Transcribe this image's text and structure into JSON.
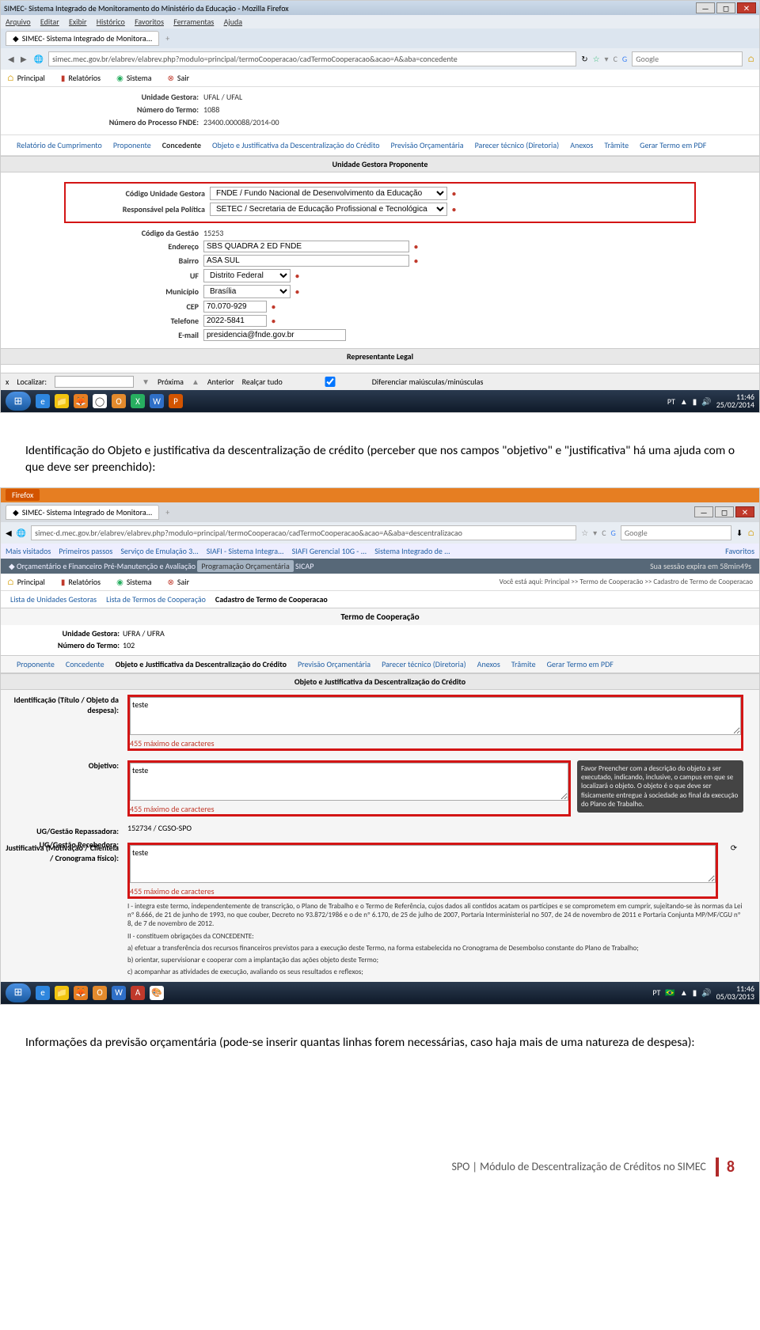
{
  "shot1": {
    "title": "SIMEC- Sistema Integrado de Monitoramento do Ministério da Educação - Mozilla Firefox",
    "menu": [
      "Arquivo",
      "Editar",
      "Exibir",
      "Histórico",
      "Favoritos",
      "Ferramentas",
      "Ajuda"
    ],
    "tab": "SIMEC- Sistema Integrado de Monitora...",
    "url": "simec.mec.gov.br/elabrev/elabrev.php?modulo=principal/termoCooperacao/cadTermoCooperacao&acao=A&aba=concedente",
    "search": "Google",
    "nav": {
      "principal": "Principal",
      "relatorios": "Relatórios",
      "sistema": "Sistema",
      "sair": "Sair"
    },
    "hdr": {
      "ug_lbl": "Unidade Gestora:",
      "ug_val": "UFAL / UFAL",
      "num_lbl": "Número do Termo:",
      "num_val": "1088",
      "proc_lbl": "Número do Processo FNDE:",
      "proc_val": "23400.000088/2014-00"
    },
    "tabs": [
      "Relatório de Cumprimento",
      "Proponente",
      "Concedente",
      "Objeto e Justificativa da Descentralização do Crédito",
      "Previsão Orçamentária",
      "Parecer técnico (Diretoria)",
      "Anexos",
      "Trâmite",
      "Gerar Termo em PDF"
    ],
    "active_tab": "Concedente",
    "sect1": "Unidade Gestora Proponente",
    "fields": {
      "cod_lbl": "Código Unidade Gestora",
      "cod_val": "FNDE / Fundo Nacional de Desenvolvimento da Educação",
      "resp_lbl": "Responsável pela Política",
      "resp_val": "SETEC / Secretaria de Educação Profissional e Tecnológica",
      "gest_lbl": "Código da Gestão",
      "gest_val": "15253",
      "end_lbl": "Endereço",
      "end_val": "SBS QUADRA 2 ED FNDE",
      "bairro_lbl": "Bairro",
      "bairro_val": "ASA SUL",
      "uf_lbl": "UF",
      "uf_val": "Distrito Federal",
      "mun_lbl": "Município",
      "mun_val": "Brasília",
      "cep_lbl": "CEP",
      "cep_val": "70.070-929",
      "tel_lbl": "Telefone",
      "tel_val": "2022-5841",
      "email_lbl": "E-mail",
      "email_val": "presidencia@fnde.gov.br"
    },
    "sect2": "Representante Legal",
    "find": {
      "x": "x",
      "loc": "Localizar:",
      "prox": "Próxima",
      "ant": "Anterior",
      "real": "Realçar tudo",
      "dif": "Diferenciar maiúsculas/minúsculas"
    },
    "clock": {
      "time": "11:46",
      "date": "25/02/2014",
      "lang": "PT"
    }
  },
  "para1": "Identificação do Objeto e justificativa da descentralização de crédito (perceber que nos campos \"objetivo\" e \"justificativa\" há uma ajuda com o que deve ser preenchido):",
  "shot2": {
    "fxbtn": "Firefox",
    "tab": "SIMEC- Sistema Integrado de Monitora...",
    "url": "simec-d.mec.gov.br/elabrev/elabrev.php?modulo=principal/termoCooperacao/cadTermoCooperacao&acao=A&aba=descentralizacao",
    "search": "Google",
    "bookmarks": [
      "Mais visitados",
      "Primeiros passos",
      "Serviço de Emulação 3...",
      "SIAFI - Sistema Integra...",
      "SIAFI Gerencial 10G - ...",
      "Sistema Integrado de ..."
    ],
    "fav": "Favoritos",
    "bc": "Orçamentário e Financeiro",
    "bc2": "Pré-Manutenção e Avaliação",
    "bc3": "Programação Orçamentária",
    "bc4": "SICAP",
    "session": "Sua sessão expira em 58min49s",
    "nav": {
      "principal": "Principal",
      "relatorios": "Relatórios",
      "sistema": "Sistema",
      "sair": "Sair"
    },
    "path": "Você está aqui: Principal >> Termo de Cooperacão >> Cadastro de Termo de Cooperacao",
    "lists": [
      "Lista de Unidades Gestoras",
      "Lista de Termos de Cooperação",
      "Cadastro de Termo de Cooperacao"
    ],
    "title": "Termo de Cooperação",
    "ug_lbl": "Unidade Gestora:",
    "ug_val": "UFRA / UFRA",
    "num_lbl": "Número do Termo:",
    "num_val": "102",
    "tabs": [
      "Proponente",
      "Concedente",
      "Objeto e Justificativa da Descentralização do Crédito",
      "Previsão Orçamentária",
      "Parecer técnico (Diretoria)",
      "Anexos",
      "Trâmite",
      "Gerar Termo em PDF"
    ],
    "active": "Objeto e Justificativa da Descentralização do Crédito",
    "sect": "Objeto e Justificativa da Descentralização do Crédito",
    "id_lbl": "Identificação (Título / Objeto da despesa):",
    "obj_lbl": "Objetivo:",
    "just_lbl": "Justificativa (Motivação / Clientela / Cronograma físico):",
    "ugrep_lbl": "UG/Gestão Repassadora:",
    "ugrep_val": "152734 / CGSO-SPO",
    "ugrec_lbl": "UG/Gestão Recebedora:",
    "teste": "teste",
    "counter": "455 máximo de caracteres",
    "tooltip": "Favor Preencher com a descrição do objeto a ser executado, indicando, inclusive, o campus em que se localizará o objeto. O objeto é o que deve ser fisicamente entregue à sociedade ao final da execução do Plano de Trabalho.",
    "footnote_i": "I - integra este termo, independentemente de transcrição, o Plano de Trabalho e o Termo de Referência, cujos dados ali contidos acatam os partícipes e se comprometem em cumprir, sujeitando-se às normas da Lei nº 8.666, de 21 de junho de 1993, no que couber, Decreto no 93.872/1986 e o de nº 6.170, de 25 de julho de 2007, Portaria Interministerial no 507, de 24 de novembro de 2011 e Portaria Conjunta MP/MF/CGU nº 8, de 7 de novembro de 2012.",
    "footnote_ii": "II - constituem obrigações da CONCEDENTE:",
    "fa": "a) efetuar a transferência dos recursos financeiros previstos para a execução deste Termo, na forma estabelecida no Cronograma de Desembolso constante do Plano de Trabalho;",
    "fb": "b) orientar, supervisionar e cooperar com a implantação das ações objeto deste Termo;",
    "fc": "c) acompanhar as atividades de execução, avaliando os seus resultados e reflexos;",
    "clock": {
      "time": "11:46",
      "date": "05/03/2013",
      "lang": "PT"
    }
  },
  "para2": "Informações da previsão orçamentária (pode-se inserir quantas linhas forem necessárias, caso haja mais de uma natureza de despesa):",
  "footer": {
    "label": "SPO | Módulo de Descentralização de Créditos no SIMEC",
    "page": "8"
  }
}
